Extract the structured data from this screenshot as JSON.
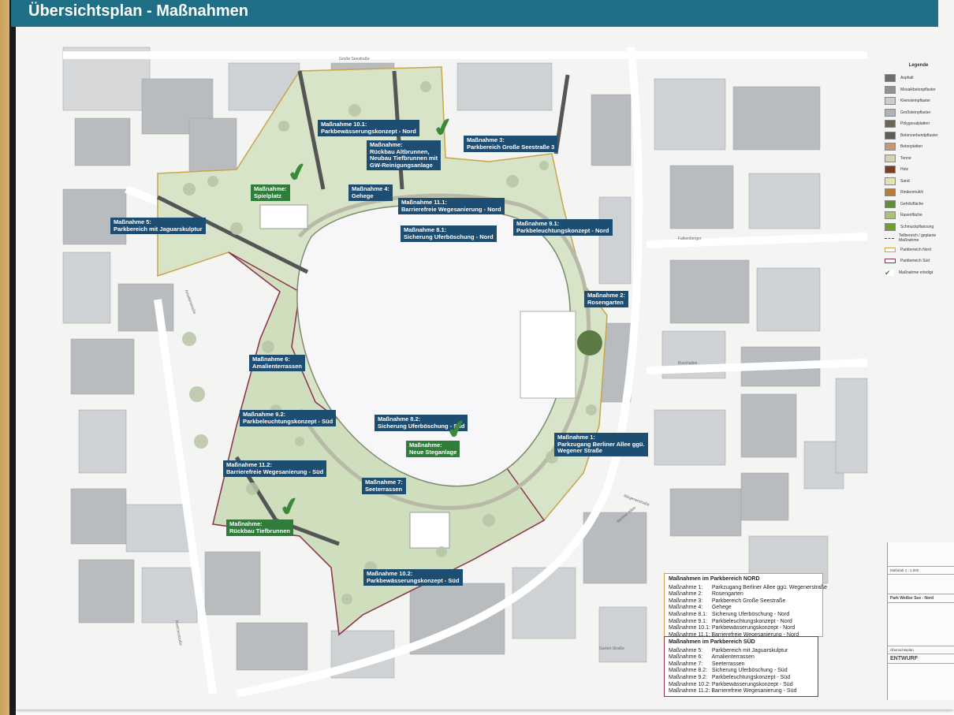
{
  "title": "Übersichtsplan - Maßnahmen",
  "labels": [
    {
      "id": "m10_1",
      "text": [
        "Maßnahme 10.1:",
        "Parkbewässerungskonzept - Nord"
      ],
      "color": "blue"
    },
    {
      "id": "rueckbau_alt",
      "text": [
        "Maßnahme:",
        "Rückbau Altbrunnen,",
        "Neubau Tiefbrunnen mit",
        "GW-Reinigungsanlage"
      ],
      "color": "green"
    },
    {
      "id": "m3",
      "text": [
        "Maßnahme 3:",
        "Parkbereich Große Seestraße 3"
      ],
      "color": "blue"
    },
    {
      "id": "spielplatz",
      "text": [
        "Maßnahme:",
        "Spielplatz"
      ],
      "color": "green"
    },
    {
      "id": "m4",
      "text": [
        "Maßnahme 4:",
        "Gehege"
      ],
      "color": "blue"
    },
    {
      "id": "m11_1",
      "text": [
        "Maßnahme 11.1:",
        "Barrierefreie Wegesanierung - Nord"
      ],
      "color": "blue"
    },
    {
      "id": "m5",
      "text": [
        "Maßnahme 5:",
        "Parkbereich mit Jaguarskulptur"
      ],
      "color": "blue"
    },
    {
      "id": "m8_1",
      "text": [
        "Maßnahme 8.1:",
        "Sicherung Uferböschung - Nord"
      ],
      "color": "blue"
    },
    {
      "id": "m9_1",
      "text": [
        "Maßnahme 9.1:",
        "Parkbeleuchtungskonzept - Nord"
      ],
      "color": "blue"
    },
    {
      "id": "m2",
      "text": [
        "Maßnahme 2:",
        "Rosengarten"
      ],
      "color": "blue"
    },
    {
      "id": "m6",
      "text": [
        "Maßnahme 6:",
        "Amalienterrassen"
      ],
      "color": "blue"
    },
    {
      "id": "m9_2",
      "text": [
        "Maßnahme 9.2:",
        "Parkbeleuchtungskonzept - Süd"
      ],
      "color": "blue"
    },
    {
      "id": "m8_2",
      "text": [
        "Maßnahme 8.2:",
        "Sicherung Uferböschung - Süd"
      ],
      "color": "blue"
    },
    {
      "id": "steganlage",
      "text": [
        "Maßnahme:",
        "Neue Steganlage"
      ],
      "color": "green"
    },
    {
      "id": "m1",
      "text": [
        "Maßnahme 1:",
        "Parkzugang Berliner Allee ggü.",
        "Wegener Straße"
      ],
      "color": "blue"
    },
    {
      "id": "m11_2",
      "text": [
        "Maßnahme 11.2:",
        "Barrierefreie Wegesanierung - Süd"
      ],
      "color": "blue"
    },
    {
      "id": "m7",
      "text": [
        "Maßnahme 7:",
        "Seeterrassen"
      ],
      "color": "blue"
    },
    {
      "id": "tiefbrunnen",
      "text": [
        "Maßnahme:",
        "Rückbau Tiefbrunnen"
      ],
      "color": "green"
    },
    {
      "id": "m10_2",
      "text": [
        "Maßnahme 10.2:",
        "Parkbewässerungskonzept - Süd"
      ],
      "color": "blue"
    }
  ],
  "streets": [
    "Große Seestraße",
    "Berliner Allee",
    "Falkenberger",
    "Amalienstraße",
    "Wegenerstraße",
    "Buschallee",
    "Garten-Straße",
    "Roelckestraße"
  ],
  "legend": {
    "title": "Legende",
    "items": [
      {
        "label": "Asphalt",
        "color": "#6e6e6e"
      },
      {
        "label": "Mosaikbetonpflaster",
        "color": "#8f9490"
      },
      {
        "label": "Kleinsteinpflaster",
        "color": "#c9cdd1"
      },
      {
        "label": "Großsteinpflaster",
        "color": "#aeb3b8"
      },
      {
        "label": "Polygonalplatten",
        "color": "#6b6655"
      },
      {
        "label": "Betonverbundpflaster",
        "color": "#5b5e5a"
      },
      {
        "label": "Betonplatten",
        "color": "#c29a7a"
      },
      {
        "label": "Tenne",
        "color": "#d8d1b0"
      },
      {
        "label": "Holz",
        "color": "#7a3e22"
      },
      {
        "label": "Sand",
        "color": "#e6e1b4"
      },
      {
        "label": "Rindenmulch",
        "color": "#b87a3a"
      },
      {
        "label": "Gehölzfläche",
        "color": "#5e8f3c"
      },
      {
        "label": "Rasenfläche",
        "color": "#a8c27a"
      },
      {
        "label": "Schmuckpflanzung",
        "color": "#6f9d34"
      },
      {
        "label": "Teilbereich / geplante Maßnahme",
        "color": "#ffffff"
      },
      {
        "label": "Parkbereich Nord",
        "color": "#ffffff"
      },
      {
        "label": "Parkbereich Süd",
        "color": "#ffffff"
      },
      {
        "label": "Maßnahme erledigt",
        "color": "#ffffff"
      }
    ]
  },
  "nord": {
    "title": "Maßnahmen im Parkbereich NORD",
    "items": [
      "Maßnahme 1:      Parkzugang Berliner Allee ggü. Wegenerstraße",
      "Maßnahme 2:      Rosengarten",
      "Maßnahme 3:      Parkbereich Große Seestraße",
      "Maßnahme 4:      Gehege",
      "Maßnahme 8.1:   Sicherung Uferböschung - Nord",
      "Maßnahme 9.1:   Parkbeleuchtungskonzept - Nord",
      "Maßnahme 10.1: Parkbewässerungskonzept - Nord",
      "Maßnahme 11.1: Barrierefreie Wegesanierung - Nord"
    ]
  },
  "sued": {
    "title": "Maßnahmen im Parkbereich SÜD",
    "items": [
      "Maßnahme 5:      Parkbereich mit Jaguarskulptur",
      "Maßnahme 6:      Amalienterrassen",
      "Maßnahme 7:      Seeterrassen",
      "Maßnahme 8.2:   Sicherung Uferböschung - Süd",
      "Maßnahme 9.2:   Parkbeleuchtungskonzept - Süd",
      "Maßnahme 10.2: Parkbewässerungskonzept - Süd",
      "Maßnahme 11.2: Barrierefreie Wegesanierung - Süd"
    ]
  },
  "titleblock": {
    "scale_label": "Maßstab",
    "scale": "1 : 1.000",
    "project": "Park Weißer See - Nord",
    "status": "ENTWURF",
    "plan": "Übersichtsplan"
  }
}
